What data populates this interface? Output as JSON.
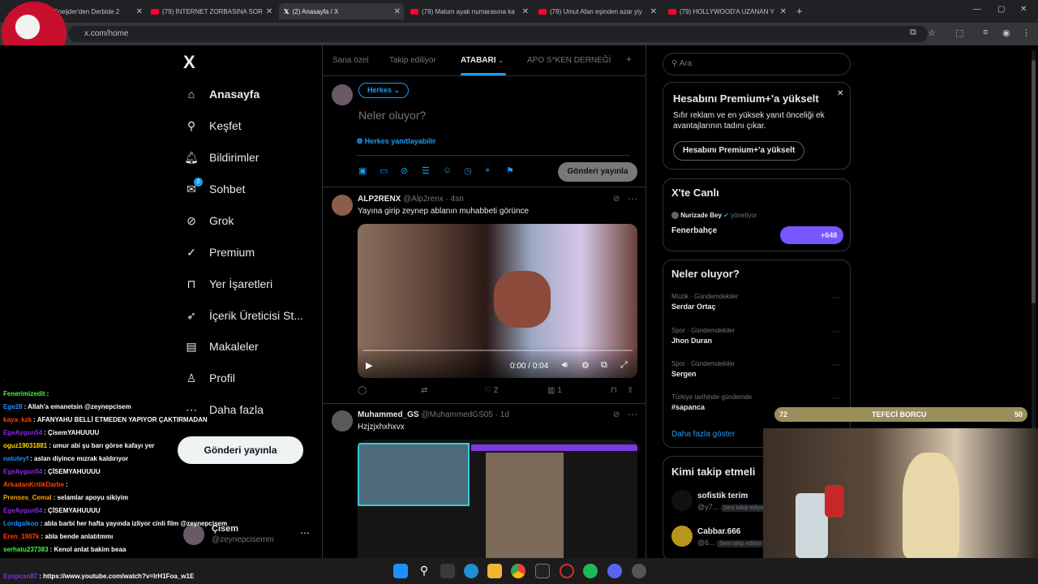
{
  "browser": {
    "tabs": [
      {
        "title": "Sneijder'den Derbide 2"
      },
      {
        "title": "(79) İNTERNET ZORBASINA SOR"
      },
      {
        "title": "(2) Anasayfa / X"
      },
      {
        "title": "(79) Malum ayak numarasına ka"
      },
      {
        "title": "(79) Umut Afan eşinden azar yiy"
      },
      {
        "title": "(79) HOLLYWOOD'A UZANAN Y"
      }
    ],
    "url": "x.com/home"
  },
  "sidebar": {
    "logo": "X",
    "items": [
      {
        "label": "Anasayfa",
        "icon": "home-icon"
      },
      {
        "label": "Keşfet",
        "icon": "search-icon"
      },
      {
        "label": "Bildirimler",
        "icon": "bell-icon"
      },
      {
        "label": "Sohbet",
        "icon": "chat-icon",
        "badge": "2"
      },
      {
        "label": "Grok",
        "icon": "grok-icon"
      },
      {
        "label": "Premium",
        "icon": "premium-icon"
      },
      {
        "label": "Yer İşaretleri",
        "icon": "bookmark-icon"
      },
      {
        "label": "İçerik Üreticisi St...",
        "icon": "rocket-icon"
      },
      {
        "label": "Makaleler",
        "icon": "article-icon"
      },
      {
        "label": "Profil",
        "icon": "person-icon"
      },
      {
        "label": "Daha fazla",
        "icon": "more-icon"
      }
    ],
    "post_button": "Gönderi yayınla",
    "account": {
      "name": "Çisem",
      "handle": "@zeynepcisemm"
    }
  },
  "timeline": {
    "tabs": [
      "Sana özel",
      "Takip ediliyor",
      "ATABARI",
      "APO S*KEN DERNEĞİ"
    ],
    "compose": {
      "audience": "Herkes",
      "placeholder": "Neler oluyor?",
      "reply_setting": "Herkes yanıtlayabilir",
      "post_button": "Gönderi yayınla"
    },
    "posts": [
      {
        "name": "ALP2RENX",
        "handle": "@Alp2renx",
        "time": "4sn",
        "text": "Yayına girip zeynep ablanın muhabbeti görünce",
        "video_time": "0:00 / 0:04",
        "likes": "2",
        "views": "1"
      },
      {
        "name": "Muhammed_GS",
        "handle": "@MuhammedGS05",
        "time": "1d",
        "text": "Hzjzjxhxhxvx"
      }
    ]
  },
  "right": {
    "search_placeholder": "Ara",
    "premium": {
      "title": "Hesabını Premium+'a yükselt",
      "body": "Sıfır reklam ve en yüksek yanıt önceliği ek avantajlarının tadını çıkar.",
      "button": "Hesabını Premium+'a yükselt"
    },
    "live": {
      "title": "X'te Canlı",
      "host": "Nurizade Bey",
      "role": "yönetiyor",
      "space": "Fenerbahçe",
      "count": "+648"
    },
    "trends": {
      "title": "Neler oluyor?",
      "items": [
        {
          "meta": "Müzik · Gündemdekiler",
          "name": "Serdar Ortaç"
        },
        {
          "meta": "Spor · Gündemdekiler",
          "name": "Jhon Duran"
        },
        {
          "meta": "Spor · Gündemdekiler",
          "name": "Sergen"
        },
        {
          "meta": "Türkiye tarihinde gündemde",
          "name": "#sapanca"
        }
      ],
      "more": "Daha fazla göster"
    },
    "follow": {
      "title": "Kimi takip etmeli",
      "items": [
        {
          "name": "sofistik terim",
          "handle": "@y7...",
          "badge": "Seni takip ediyor"
        },
        {
          "name": "Cabbar.666",
          "handle": "@6...",
          "badge": "Seni takip ediyor"
        }
      ]
    }
  },
  "overlay": {
    "bar": {
      "left": "72",
      "label": "TEFECİ BORCU",
      "right": "50"
    },
    "chat": [
      {
        "user": "Fenerimizedit",
        "msg": ":",
        "color": "#3cff3c"
      },
      {
        "user": "Ege28",
        "msg": ": Allah'a emanetsin @zeynepcisem",
        "color": "#1e90ff"
      },
      {
        "user": "kaya_kzk",
        "msg": ": AFANYAHU BELLİ ETMEDEN YAPIYOR ÇAKTIRMADAN",
        "color": "#ff4500"
      },
      {
        "user": "EgeAygun54",
        "msg": ": ÇisemYAHUUUU",
        "color": "#8a2be2"
      },
      {
        "user": "oguz19031881",
        "msg": ": umur abi şu barı görse kafayı yer",
        "color": "#ffd700"
      },
      {
        "user": "natuteyf",
        "msg": ": aslan diyince mızrak kaldırıyor",
        "color": "#1e90ff"
      },
      {
        "user": "EgeAygun54",
        "msg": ": ÇİSEMYAHUUUU",
        "color": "#8a2be2"
      },
      {
        "user": "ArkadanKritikDarbe",
        "msg": ":",
        "color": "#ff4500"
      },
      {
        "user": "Prenses_Cemal",
        "msg": ": selamlar apoyu sikiyim",
        "color": "#ffa500"
      },
      {
        "user": "EgeAygun54",
        "msg": ": ÇİSEMYAHUUUU",
        "color": "#8a2be2"
      },
      {
        "user": "Lordgalkoo",
        "msg": ": abla barbi her hafta yayında izliyor cinli film @zeynepcisem",
        "color": "#1e90ff"
      },
      {
        "user": "Eren_1907k",
        "msg": ": abla bende anlatıtmmı",
        "color": "#ff4500"
      },
      {
        "user": "serhatu237383",
        "msg": ": Kenol anlat bakim beaa",
        "color": "#3cff3c"
      },
      {
        "user": "Eyupcan87",
        "msg": ": https://www.youtube.com/watch?v=lrH1Foa_w1E",
        "color": "#8a2be2"
      }
    ]
  },
  "colors": {
    "accent": "#1d9bf0",
    "bg": "#000000",
    "border": "#2f3336",
    "muted": "#71767b"
  }
}
